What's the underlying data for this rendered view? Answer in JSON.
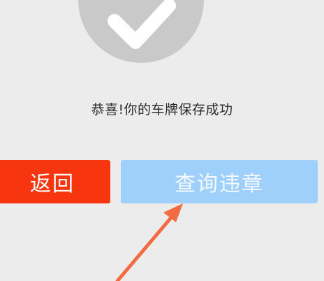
{
  "status": {
    "message": "恭喜!你的车牌保存成功",
    "icon": "check-circle-icon"
  },
  "buttons": {
    "back_label": "返回",
    "query_label": "查询违章"
  },
  "colors": {
    "background": "#ececec",
    "icon_circle": "#c9c9c9",
    "back_button": "#f7360f",
    "query_button": "#9fd0fb",
    "annotation_arrow": "#f26b43"
  }
}
